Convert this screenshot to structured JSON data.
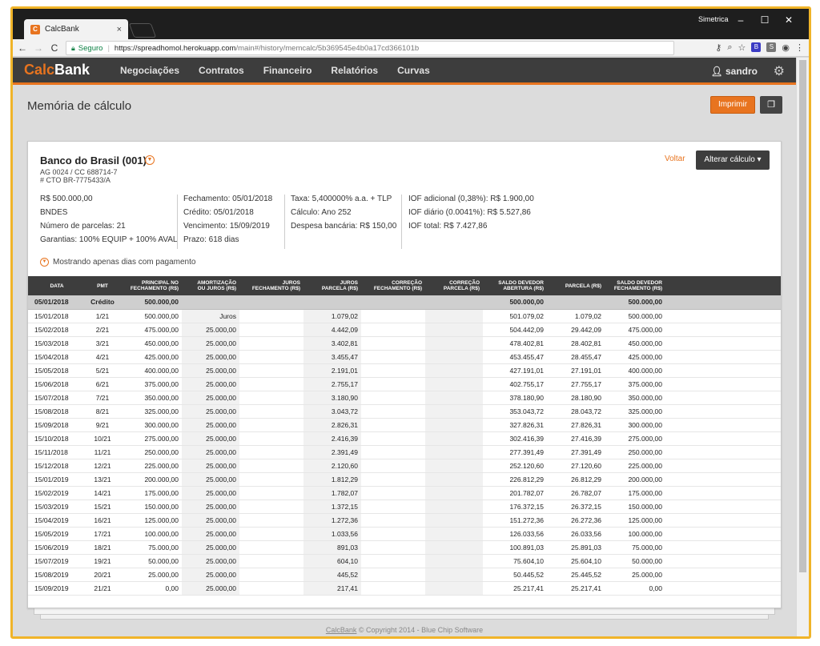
{
  "browser": {
    "tab_title": "CalcBank",
    "tab_close": "×",
    "window_user": "Simetrica",
    "win_min": "–",
    "win_max": "☐",
    "win_close": "✕",
    "back": "←",
    "forward": "→",
    "reload": "C",
    "secure_label": "Seguro",
    "url_separator": "|",
    "url_host": "https://spreadhomol.herokuapp.com",
    "url_path": "/main#/history/memcalc/5b369545e4b0a17cd366101b"
  },
  "app": {
    "logo_part1": "Calc",
    "logo_part2": "Bank",
    "menu": [
      "Negociações",
      "Contratos",
      "Financeiro",
      "Relatórios",
      "Curvas"
    ],
    "username": "sandro"
  },
  "page": {
    "title": "Memória de cálculo",
    "print_label": "Imprimir",
    "back_label": "Voltar",
    "change_label": "Alterar cálculo ▾",
    "footer_link": "CalcBank",
    "footer_text": " © Copyright 2014 - Blue Chip Software"
  },
  "contract": {
    "bank": "Banco do Brasil (001)",
    "agency": "AG 0024 / CC 688714-7",
    "cto": "# CTO BR-7775433/A",
    "col1": [
      "R$ 500.000,00",
      "BNDES",
      "Número de parcelas: 21",
      "Garantias: 100% EQUIP + 100% AVAL"
    ],
    "col2": [
      "Fechamento: 05/01/2018",
      "Crédito: 05/01/2018",
      "Vencimento: 15/09/2019",
      "Prazo: 618 dias"
    ],
    "col3": [
      "Taxa: 5,400000% a.a. + TLP",
      "Cálculo: Ano 252",
      "Despesa bancária: R$ 150,00"
    ],
    "col4": [
      "IOF adicional (0,38%): R$ 1.900,00",
      "IOF diário (0.0041%): R$ 5.527,86",
      "IOF total: R$ 7.427,86"
    ],
    "filter": "Mostrando apenas dias com pagamento"
  },
  "table": {
    "headers": [
      [
        "DATA"
      ],
      [
        "PMT"
      ],
      [
        "PRINCIPAL NO",
        "FECHAMENTO (R$)"
      ],
      [
        "AMORTIZAÇÃO",
        "OU JUROS (R$)"
      ],
      [
        "JUROS",
        "FECHAMENTO (R$)"
      ],
      [
        "JUROS",
        "PARCELA (R$)"
      ],
      [
        "CORREÇÃO",
        "FECHAMENTO (R$)"
      ],
      [
        "CORREÇÃO",
        "PARCELA (R$)"
      ],
      [
        "SALDO DEVEDOR",
        "ABERTURA (R$)"
      ],
      [
        "PARCELA (R$)"
      ],
      [
        "SALDO DEVEDOR",
        "FECHAMENTO (R$)"
      ]
    ],
    "opening": [
      "05/01/2018",
      "Crédito",
      "500.000,00",
      "",
      "",
      "",
      "",
      "",
      "500.000,00",
      "",
      "500.000,00"
    ],
    "rows": [
      [
        "15/01/2018",
        "1/21",
        "500.000,00",
        "Juros",
        "",
        "1.079,02",
        "",
        "",
        "501.079,02",
        "1.079,02",
        "500.000,00"
      ],
      [
        "15/02/2018",
        "2/21",
        "475.000,00",
        "25.000,00",
        "",
        "4.442,09",
        "",
        "",
        "504.442,09",
        "29.442,09",
        "475.000,00"
      ],
      [
        "15/03/2018",
        "3/21",
        "450.000,00",
        "25.000,00",
        "",
        "3.402,81",
        "",
        "",
        "478.402,81",
        "28.402,81",
        "450.000,00"
      ],
      [
        "15/04/2018",
        "4/21",
        "425.000,00",
        "25.000,00",
        "",
        "3.455,47",
        "",
        "",
        "453.455,47",
        "28.455,47",
        "425.000,00"
      ],
      [
        "15/05/2018",
        "5/21",
        "400.000,00",
        "25.000,00",
        "",
        "2.191,01",
        "",
        "",
        "427.191,01",
        "27.191,01",
        "400.000,00"
      ],
      [
        "15/06/2018",
        "6/21",
        "375.000,00",
        "25.000,00",
        "",
        "2.755,17",
        "",
        "",
        "402.755,17",
        "27.755,17",
        "375.000,00"
      ],
      [
        "15/07/2018",
        "7/21",
        "350.000,00",
        "25.000,00",
        "",
        "3.180,90",
        "",
        "",
        "378.180,90",
        "28.180,90",
        "350.000,00"
      ],
      [
        "15/08/2018",
        "8/21",
        "325.000,00",
        "25.000,00",
        "",
        "3.043,72",
        "",
        "",
        "353.043,72",
        "28.043,72",
        "325.000,00"
      ],
      [
        "15/09/2018",
        "9/21",
        "300.000,00",
        "25.000,00",
        "",
        "2.826,31",
        "",
        "",
        "327.826,31",
        "27.826,31",
        "300.000,00"
      ],
      [
        "15/10/2018",
        "10/21",
        "275.000,00",
        "25.000,00",
        "",
        "2.416,39",
        "",
        "",
        "302.416,39",
        "27.416,39",
        "275.000,00"
      ],
      [
        "15/11/2018",
        "11/21",
        "250.000,00",
        "25.000,00",
        "",
        "2.391,49",
        "",
        "",
        "277.391,49",
        "27.391,49",
        "250.000,00"
      ],
      [
        "15/12/2018",
        "12/21",
        "225.000,00",
        "25.000,00",
        "",
        "2.120,60",
        "",
        "",
        "252.120,60",
        "27.120,60",
        "225.000,00"
      ],
      [
        "15/01/2019",
        "13/21",
        "200.000,00",
        "25.000,00",
        "",
        "1.812,29",
        "",
        "",
        "226.812,29",
        "26.812,29",
        "200.000,00"
      ],
      [
        "15/02/2019",
        "14/21",
        "175.000,00",
        "25.000,00",
        "",
        "1.782,07",
        "",
        "",
        "201.782,07",
        "26.782,07",
        "175.000,00"
      ],
      [
        "15/03/2019",
        "15/21",
        "150.000,00",
        "25.000,00",
        "",
        "1.372,15",
        "",
        "",
        "176.372,15",
        "26.372,15",
        "150.000,00"
      ],
      [
        "15/04/2019",
        "16/21",
        "125.000,00",
        "25.000,00",
        "",
        "1.272,36",
        "",
        "",
        "151.272,36",
        "26.272,36",
        "125.000,00"
      ],
      [
        "15/05/2019",
        "17/21",
        "100.000,00",
        "25.000,00",
        "",
        "1.033,56",
        "",
        "",
        "126.033,56",
        "26.033,56",
        "100.000,00"
      ],
      [
        "15/06/2019",
        "18/21",
        "75.000,00",
        "25.000,00",
        "",
        "891,03",
        "",
        "",
        "100.891,03",
        "25.891,03",
        "75.000,00"
      ],
      [
        "15/07/2019",
        "19/21",
        "50.000,00",
        "25.000,00",
        "",
        "604,10",
        "",
        "",
        "75.604,10",
        "25.604,10",
        "50.000,00"
      ],
      [
        "15/08/2019",
        "20/21",
        "25.000,00",
        "25.000,00",
        "",
        "445,52",
        "",
        "",
        "50.445,52",
        "25.445,52",
        "25.000,00"
      ],
      [
        "15/09/2019",
        "21/21",
        "0,00",
        "25.000,00",
        "",
        "217,41",
        "",
        "",
        "25.217,41",
        "25.217,41",
        "0,00"
      ]
    ]
  },
  "colors": {
    "accent": "#e8741f",
    "navbar": "#3d3d3d",
    "frame": "#f0b429"
  }
}
